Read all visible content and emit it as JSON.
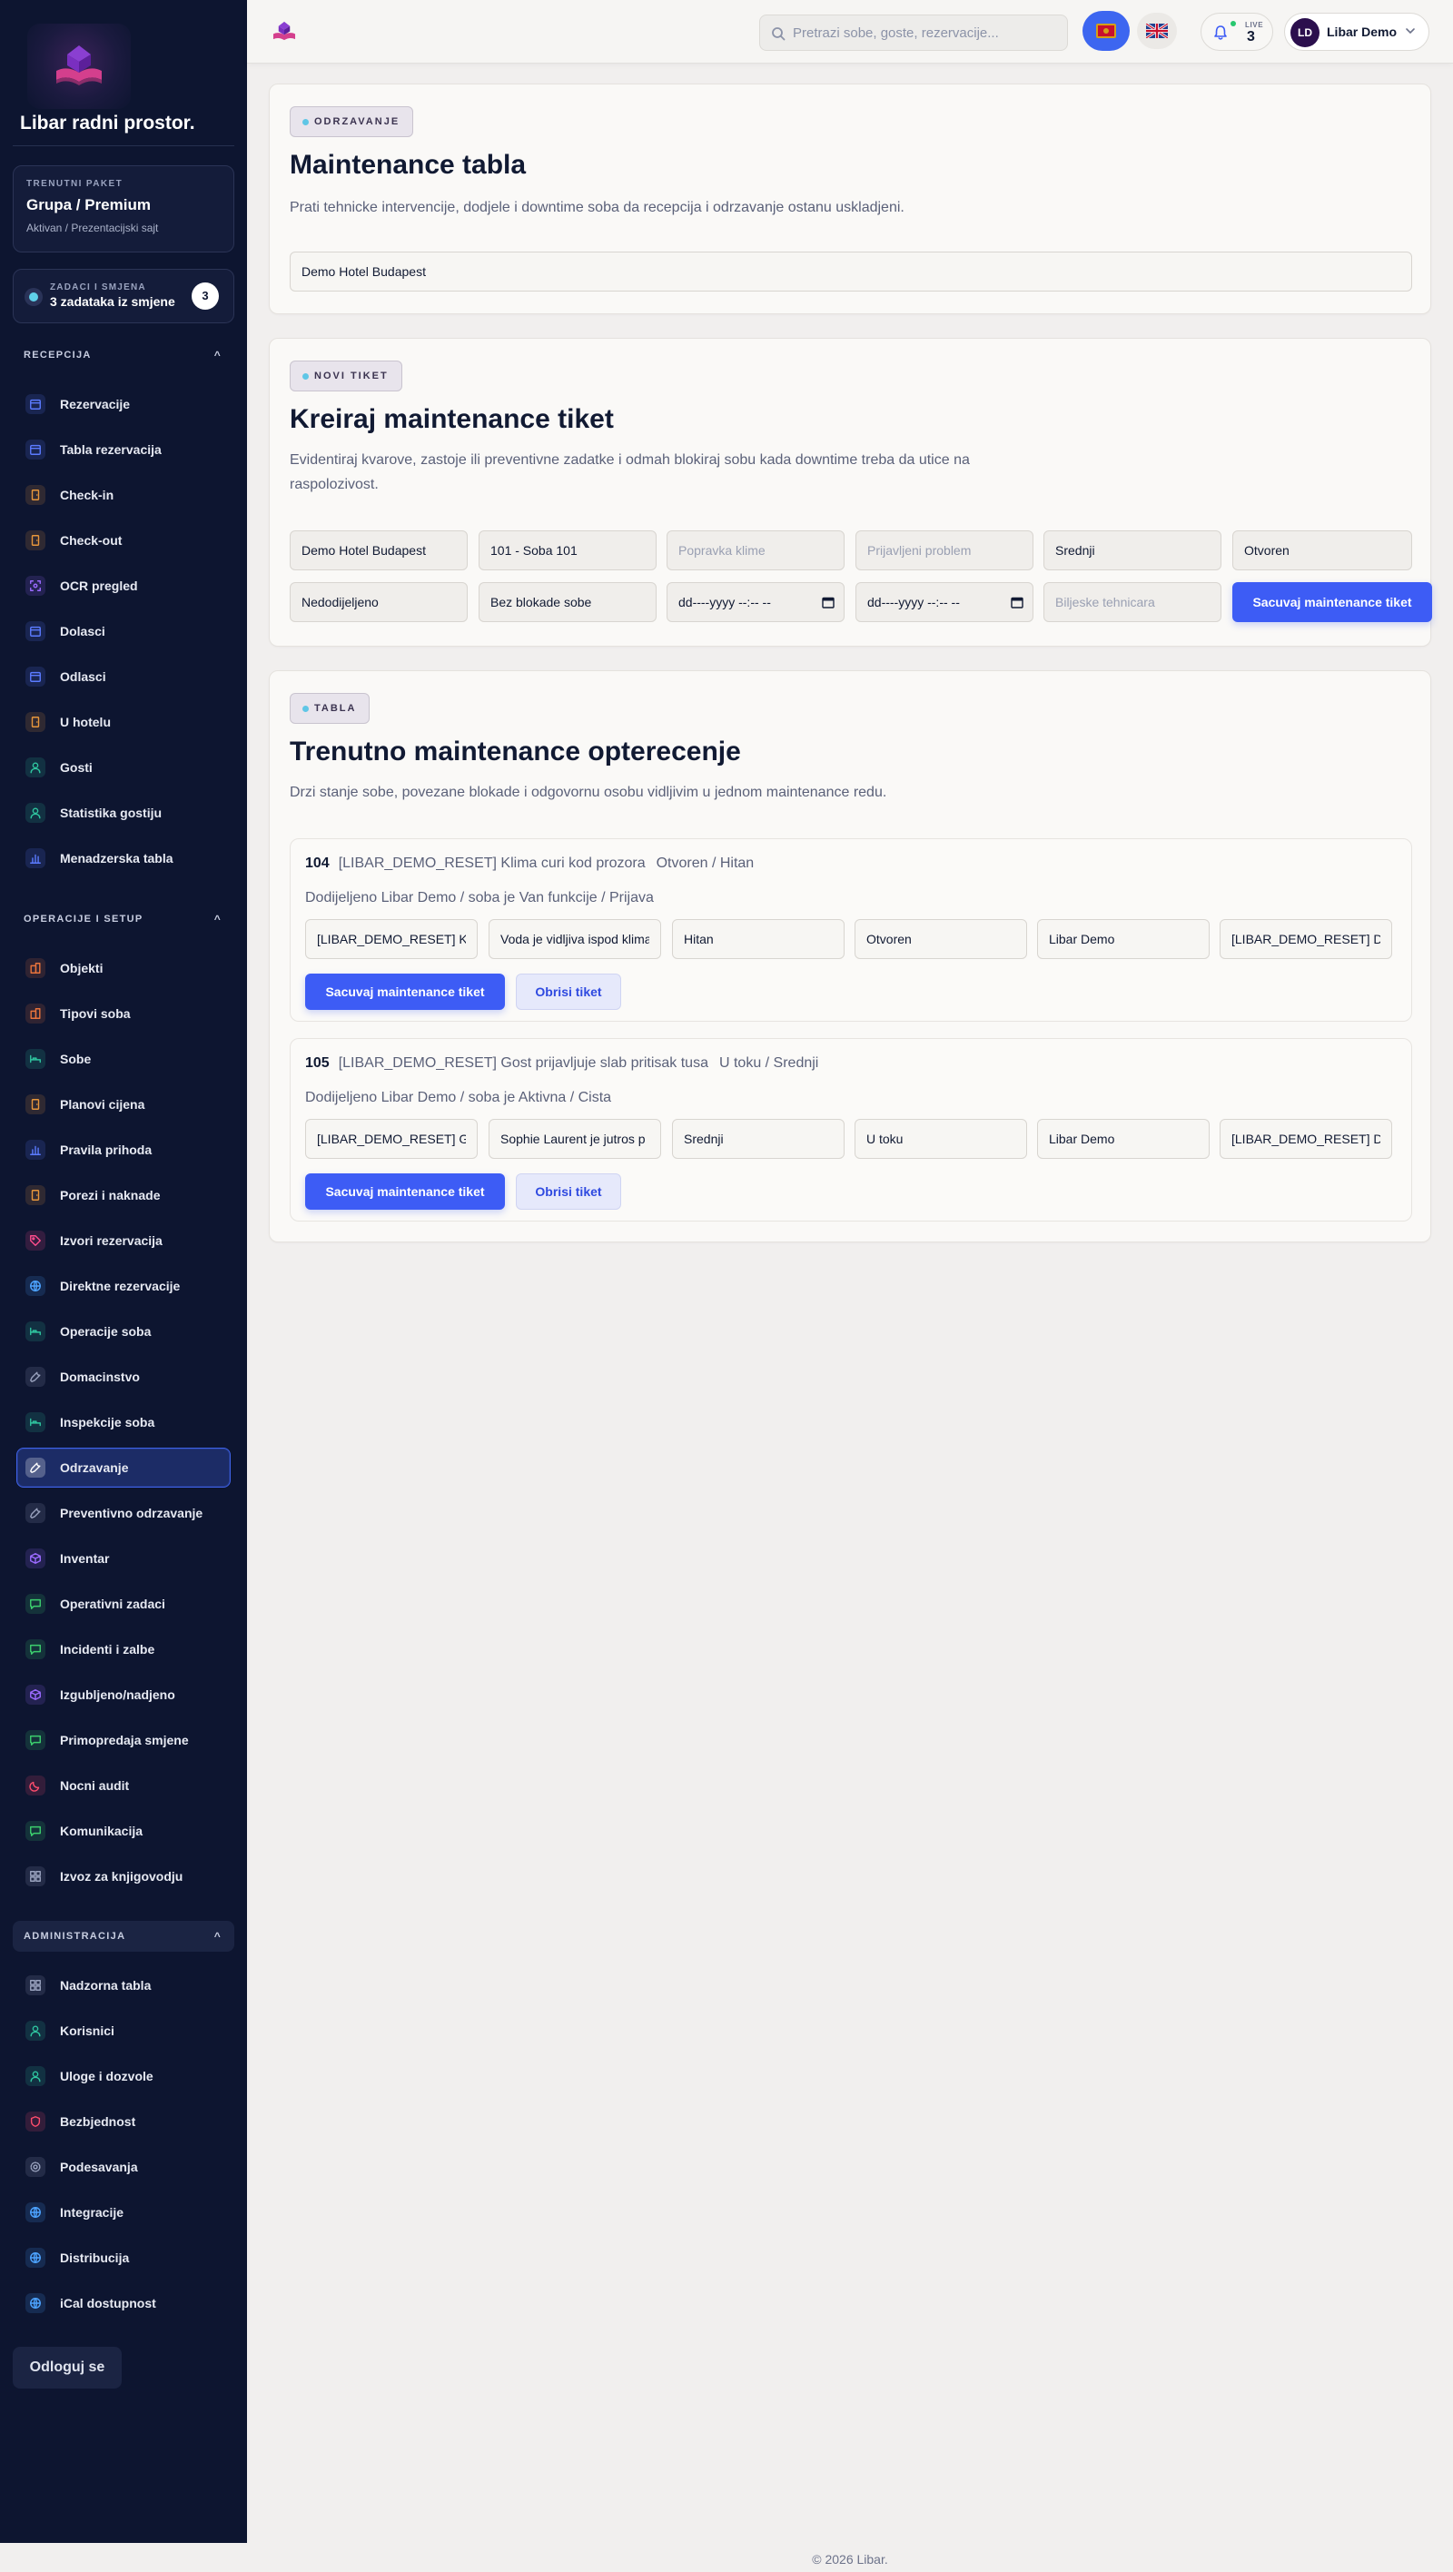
{
  "sidebar": {
    "brand": "Libar radni prostor.",
    "package": {
      "caption": "TRENUTNI PAKET",
      "title": "Grupa / Premium",
      "subtitle": "Aktivan / Prezentacijski sajt"
    },
    "tasks": {
      "caption": "ZADACI I SMJENA",
      "text": "3 zadataka iz smjene",
      "count": "3"
    },
    "sections": [
      {
        "title": "RECEPCIJA",
        "caret": "^"
      },
      {
        "title": "OPERACIJE I SETUP",
        "caret": "^"
      },
      {
        "title": "ADMINISTRACIJA",
        "caret": "^"
      }
    ],
    "reception": [
      {
        "label": "Rezervacije",
        "icon": "calendar-icon",
        "color": "#5b7bff"
      },
      {
        "label": "Tabla rezervacija",
        "icon": "calendar-icon",
        "color": "#5b7bff"
      },
      {
        "label": "Check-in",
        "icon": "door-icon",
        "color": "#e8973c"
      },
      {
        "label": "Check-out",
        "icon": "door-icon",
        "color": "#e8973c"
      },
      {
        "label": "OCR pregled",
        "icon": "scan-icon",
        "color": "#9b6bff"
      },
      {
        "label": "Dolasci",
        "icon": "calendar-icon",
        "color": "#5b7bff"
      },
      {
        "label": "Odlasci",
        "icon": "calendar-icon",
        "color": "#5b7bff"
      },
      {
        "label": "U hotelu",
        "icon": "door-icon",
        "color": "#e8973c"
      },
      {
        "label": "Gosti",
        "icon": "user-icon",
        "color": "#2fc6a0"
      },
      {
        "label": "Statistika gostiju",
        "icon": "user-icon",
        "color": "#2fc6a0"
      },
      {
        "label": "Menadzerska tabla",
        "icon": "bar-chart-icon",
        "color": "#5b7bff"
      }
    ],
    "operations": [
      {
        "label": "Objekti",
        "icon": "building-icon",
        "color": "#e8733c"
      },
      {
        "label": "Tipovi soba",
        "icon": "building-icon",
        "color": "#e8733c"
      },
      {
        "label": "Sobe",
        "icon": "bed-icon",
        "color": "#2fc6a0"
      },
      {
        "label": "Planovi cijena",
        "icon": "door-icon",
        "color": "#e8973c"
      },
      {
        "label": "Pravila prihoda",
        "icon": "bar-chart-icon",
        "color": "#5b7bff"
      },
      {
        "label": "Porezi i naknade",
        "icon": "door-icon",
        "color": "#e8973c"
      },
      {
        "label": "Izvori rezervacija",
        "icon": "tag-icon",
        "color": "#ff4d8d"
      },
      {
        "label": "Direktne rezervacije",
        "icon": "globe-icon",
        "color": "#4da3ff"
      },
      {
        "label": "Operacije soba",
        "icon": "bed-icon",
        "color": "#2fc6a0"
      },
      {
        "label": "Domacinstvo",
        "icon": "wrench-icon",
        "color": "#9aa3bf"
      },
      {
        "label": "Inspekcije soba",
        "icon": "bed-icon",
        "color": "#2fc6a0"
      },
      {
        "label": "Odrzavanje",
        "icon": "wrench-icon",
        "color": "#ffffff",
        "active": true
      },
      {
        "label": "Preventivno odrzavanje",
        "icon": "wrench-icon",
        "color": "#9aa3bf"
      },
      {
        "label": "Inventar",
        "icon": "box-icon",
        "color": "#9b6bff"
      },
      {
        "label": "Operativni zadaci",
        "icon": "chat-icon",
        "color": "#3ccf6e"
      },
      {
        "label": "Incidenti i zalbe",
        "icon": "chat-icon",
        "color": "#3ccf6e"
      },
      {
        "label": "Izgubljeno/nadjeno",
        "icon": "box-icon",
        "color": "#9b6bff"
      },
      {
        "label": "Primopredaja smjene",
        "icon": "chat-icon",
        "color": "#3ccf6e"
      },
      {
        "label": "Nocni audit",
        "icon": "moon-icon",
        "color": "#ff4d6d"
      },
      {
        "label": "Komunikacija",
        "icon": "chat-icon",
        "color": "#3ccf6e"
      },
      {
        "label": "Izvoz za knjigovodju",
        "icon": "grid-icon",
        "color": "#9aa3bf"
      }
    ],
    "administration": [
      {
        "label": "Nadzorna tabla",
        "icon": "grid-icon",
        "color": "#9aa3bf"
      },
      {
        "label": "Korisnici",
        "icon": "user-icon",
        "color": "#2fc6a0"
      },
      {
        "label": "Uloge i dozvole",
        "icon": "user-icon",
        "color": "#2fc6a0"
      },
      {
        "label": "Bezbjednost",
        "icon": "shield-icon",
        "color": "#ff4d6d"
      },
      {
        "label": "Podesavanja",
        "icon": "gear-icon",
        "color": "#9aa3bf"
      },
      {
        "label": "Integracije",
        "icon": "globe-icon",
        "color": "#4da3ff"
      },
      {
        "label": "Distribucija",
        "icon": "globe-icon",
        "color": "#4da3ff"
      },
      {
        "label": "iCal dostupnost",
        "icon": "globe-icon",
        "color": "#4da3ff"
      }
    ],
    "logout": "Odloguj se"
  },
  "topbar": {
    "search_placeholder": "Pretrazi sobe, goste, rezervacije...",
    "notifications": {
      "live": "LIVE",
      "count": "3"
    },
    "user": {
      "initials": "LD",
      "name": "Libar Demo"
    }
  },
  "maintenance": {
    "pill": "ODRZAVANJE",
    "title": "Maintenance tabla",
    "description": "Prati tehnicke intervencije, dodjele i downtime soba da recepcija i odrzavanje ostanu uskladjeni.",
    "property": "Demo Hotel Budapest"
  },
  "new_ticket": {
    "pill": "NOVI TIKET",
    "title": "Kreiraj maintenance tiket",
    "description": "Evidentiraj kvarove, zastoje ili preventivne zadatke i odmah blokiraj sobu kada downtime treba da utice na raspolozivost.",
    "property": "Demo Hotel Budapest",
    "room": "101 - Soba 101",
    "title_placeholder": "Popravka klime",
    "problem_placeholder": "Prijavljeni problem",
    "priority": "Srednji",
    "status": "Otvoren",
    "assignee": "Nedodijeljeno",
    "block": "Bez blokade sobe",
    "date_from": "dd----yyyy --:-- --",
    "date_to": "dd----yyyy --:-- --",
    "notes_placeholder": "Biljeske tehnicara",
    "save": "Sacuvaj maintenance tiket"
  },
  "board": {
    "pill": "TABLA",
    "title": "Trenutno maintenance opterecenje",
    "description": "Drzi stanje sobe, povezane blokade i odgovornu osobu vidljivim u jednom maintenance redu.",
    "tickets": [
      {
        "room": "104",
        "title": "[LIBAR_DEMO_RESET] Klima curi kod prozora",
        "status_line": "Otvoren / Hitan",
        "subline": "Dodijeljeno Libar Demo / soba je Van funkcije / Prijava",
        "fields": [
          "[LIBAR_DEMO_RESET] Kli",
          "Voda je vidljiva ispod klima",
          "Hitan",
          "Otvoren",
          "Libar Demo",
          "[LIBAR_DEMO_RESET] De"
        ],
        "save": "Sacuvaj maintenance tiket",
        "delete": "Obrisi tiket"
      },
      {
        "room": "105",
        "title": "[LIBAR_DEMO_RESET] Gost prijavljuje slab pritisak tusa",
        "status_line": "U toku / Srednji",
        "subline": "Dodijeljeno Libar Demo / soba je Aktivna / Cista",
        "fields": [
          "[LIBAR_DEMO_RESET] Go",
          "Sophie Laurent je jutros p",
          "Srednji",
          "U toku",
          "Libar Demo",
          "[LIBAR_DEMO_RESET] De"
        ],
        "save": "Sacuvaj maintenance tiket",
        "delete": "Obrisi tiket"
      }
    ]
  },
  "footer": "© 2026 Libar."
}
